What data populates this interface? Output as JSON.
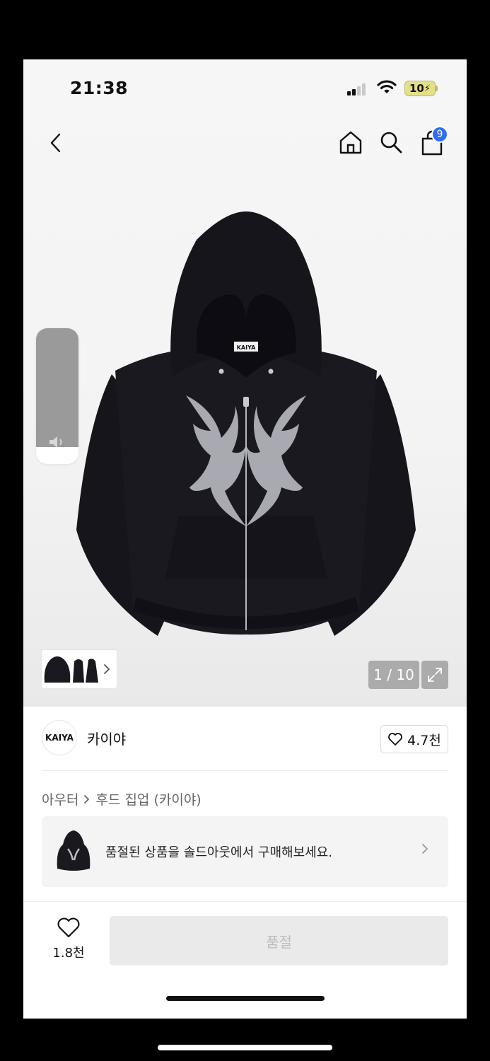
{
  "status": {
    "time": "21:38",
    "battery": "10"
  },
  "nav": {
    "cart_count": "9"
  },
  "gallery": {
    "counter": "1 / 10"
  },
  "product": {
    "brand_logo": "KAIYA",
    "brand_name": "카이야",
    "brand_likes": "4.7천",
    "category": "아우터",
    "subcategory": "후드 집업 (카이야)",
    "hood_label": "KAIYA"
  },
  "banner": {
    "text": "품절된 상품을 솔드아웃에서 구매해보세요."
  },
  "footer": {
    "wish_count": "1.8천",
    "buy_label": "품절"
  },
  "colors": {
    "accent": "#2f6df6",
    "battery": "#e3e089",
    "hoodie": "#16151c"
  }
}
